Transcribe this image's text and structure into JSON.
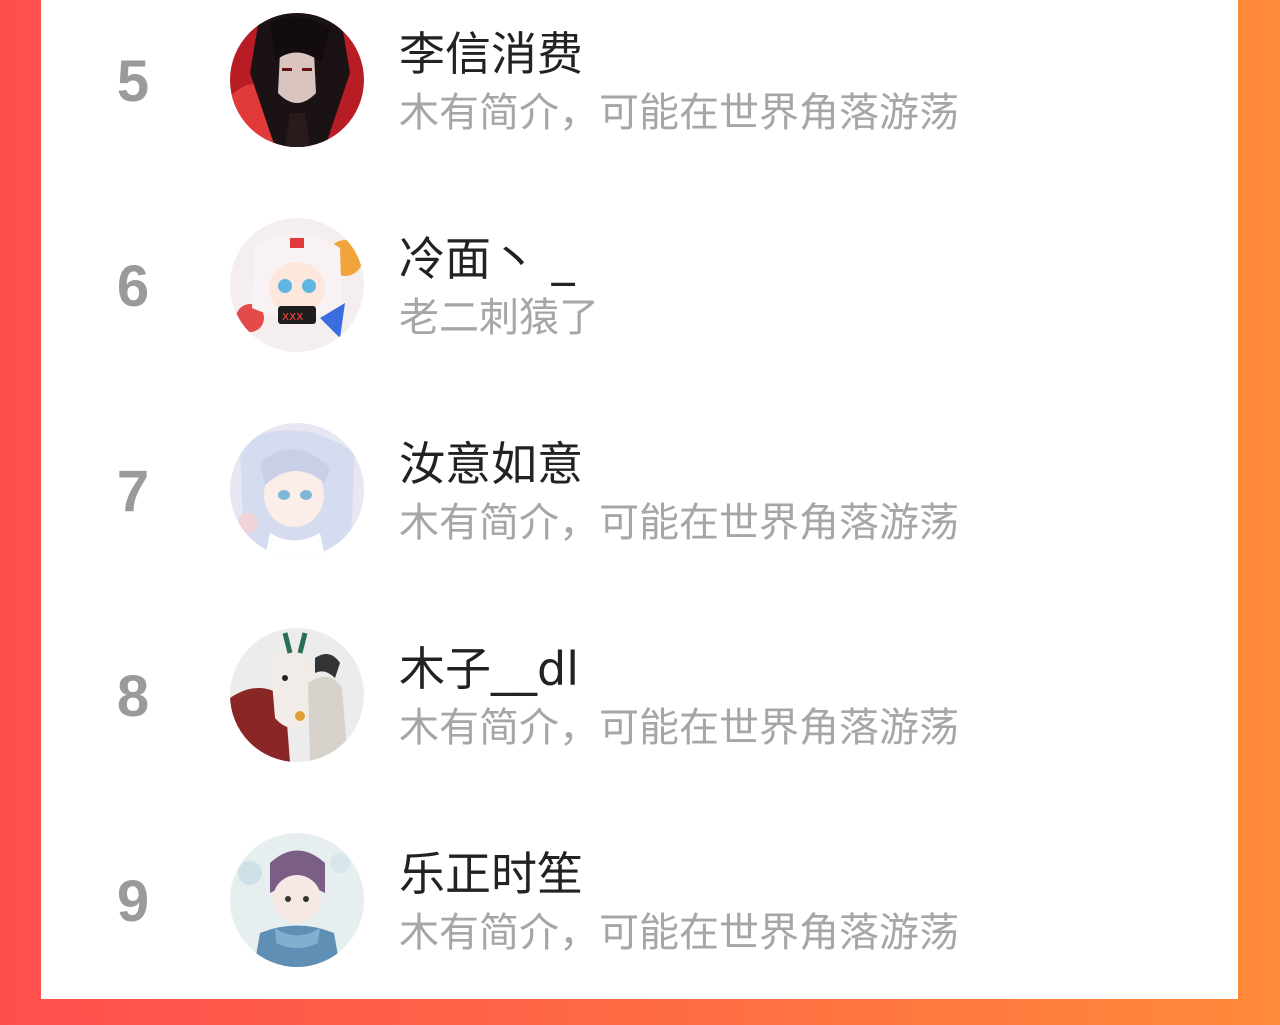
{
  "colors": {
    "background_left": "#ff4e4e",
    "background_right": "#ff8a3a",
    "rank_text": "#9a9a9a",
    "name_text": "#222222",
    "bio_text": "#a6a6a6"
  },
  "users": [
    {
      "rank": "5",
      "name": "李信消费",
      "bio": "木有简介，可能在世界角落游荡",
      "avatar": "avatar-dark-red-anime"
    },
    {
      "rank": "6",
      "name": "冷面丶 _",
      "bio": "老二刺猿了",
      "avatar": "avatar-white-hair-anime"
    },
    {
      "rank": "7",
      "name": "汝意如意",
      "bio": "木有简介，可能在世界角落游荡",
      "avatar": "avatar-pastel-anime"
    },
    {
      "rank": "8",
      "name": "木子__dl",
      "bio": "木有简介，可能在世界角落游荡",
      "avatar": "avatar-deer-illustration"
    },
    {
      "rank": "9",
      "name": "乐正时笙",
      "bio": "木有简介，可能在世界角落游荡",
      "avatar": "avatar-boy-illustration"
    }
  ]
}
